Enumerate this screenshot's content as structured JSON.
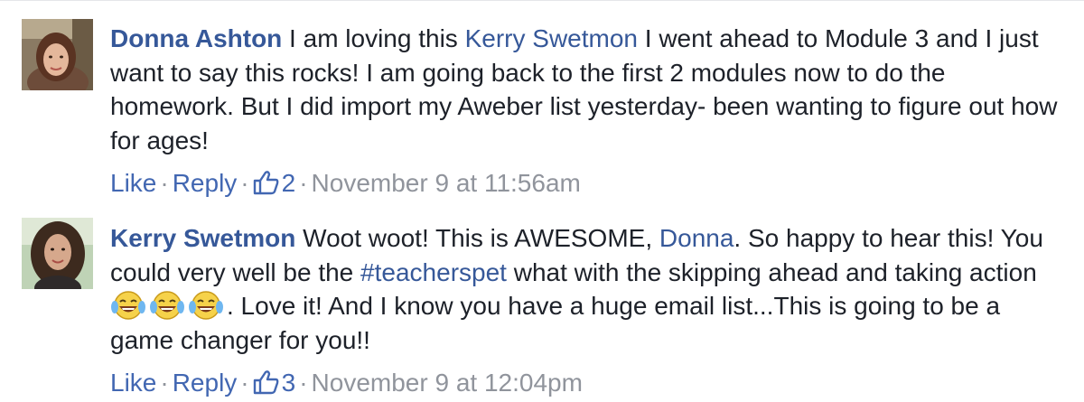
{
  "comments": [
    {
      "author": "Donna Ashton",
      "text_1": " I am loving this ",
      "mention": "Kerry Swetmon",
      "text_2": " I went ahead to Module 3 and I just want to say this rocks! I am going back to the first 2 modules now to do the homework. But I did import my Aweber list yesterday- been wanting to figure out how for ages!",
      "like_label": "Like",
      "reply_label": "Reply",
      "like_count": "2",
      "timestamp": "November 9 at 11:56am",
      "separator": "·"
    },
    {
      "author": "Kerry Swetmon",
      "text_1": " Woot woot! This is AWESOME, ",
      "mention": "Donna",
      "text_2": ". So happy to hear this! You could very well be the ",
      "hashtag": "#teacherspet",
      "text_3": " what with the skipping ahead and taking action ",
      "text_4": ". Love it! And I know you have a huge email list...This is going to be a game changer for you!!",
      "emoji": [
        "laughing-crying-emoji",
        "laughing-crying-emoji",
        "laughing-crying-emoji"
      ],
      "like_label": "Like",
      "reply_label": "Reply",
      "like_count": "3",
      "timestamp": "November 9 at 12:04pm",
      "separator": "·"
    }
  ],
  "colors": {
    "link": "#365899",
    "action_link": "#4267b2",
    "meta": "#90949c",
    "text": "#1d2129"
  }
}
